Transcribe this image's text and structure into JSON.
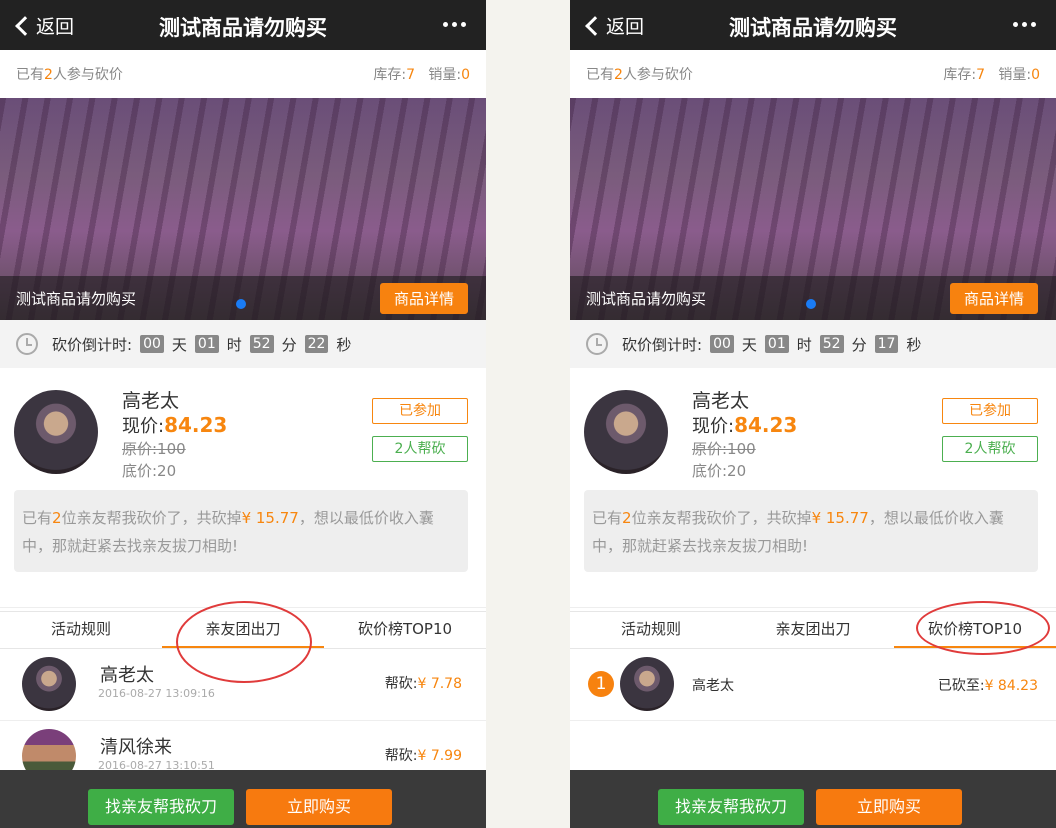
{
  "header": {
    "back_label": "返回",
    "title": "测试商品请勿购买"
  },
  "stats": {
    "participants_prefix": "已有",
    "participants_count": "2",
    "participants_suffix": "人参与砍价",
    "stock_label": "库存:",
    "stock_value": "7",
    "sales_label": "销量:",
    "sales_value": "0"
  },
  "banner": {
    "caption": "测试商品请勿购买",
    "detail_button": "商品详情"
  },
  "countdown": {
    "label": "砍价倒计时:",
    "day_unit": "天",
    "hour_unit": "时",
    "minute_unit": "分",
    "second_unit": "秒",
    "left": {
      "days": "00",
      "hours": "01",
      "minutes": "52",
      "seconds": "22"
    },
    "right": {
      "days": "00",
      "hours": "01",
      "minutes": "52",
      "seconds": "17"
    }
  },
  "user": {
    "name": "高老太",
    "current_price_label": "现价:",
    "current_price": "84.23",
    "original_price": "原价:100",
    "floor_price": "底价:20",
    "joined_button": "已参加",
    "helpers_button": "2人帮砍"
  },
  "notice": {
    "p1": "已有",
    "count": "2",
    "p2": "位亲友帮我砍价了，共砍掉",
    "amount": "¥ 15.77",
    "p3": "，想以最低价收入囊中，那就赶紧去找亲友拔刀相助!"
  },
  "tabs": [
    "活动规则",
    "亲友团出刀",
    "砍价榜TOP10"
  ],
  "helpers": [
    {
      "name": "高老太",
      "time": "2016-08-27 13:09:16",
      "help_label": "帮砍:",
      "amount": "¥ 7.78"
    },
    {
      "name": "清风徐来",
      "time": "2016-08-27 13:10:51",
      "help_label": "帮砍:",
      "amount": "¥ 7.99"
    }
  ],
  "ranking": [
    {
      "rank": "1",
      "name": "高老太",
      "to_label": "已砍至:",
      "amount": "¥ 84.23"
    }
  ],
  "footer": {
    "find_button": "找亲友帮我砍刀",
    "buy_button": "立即购买"
  }
}
